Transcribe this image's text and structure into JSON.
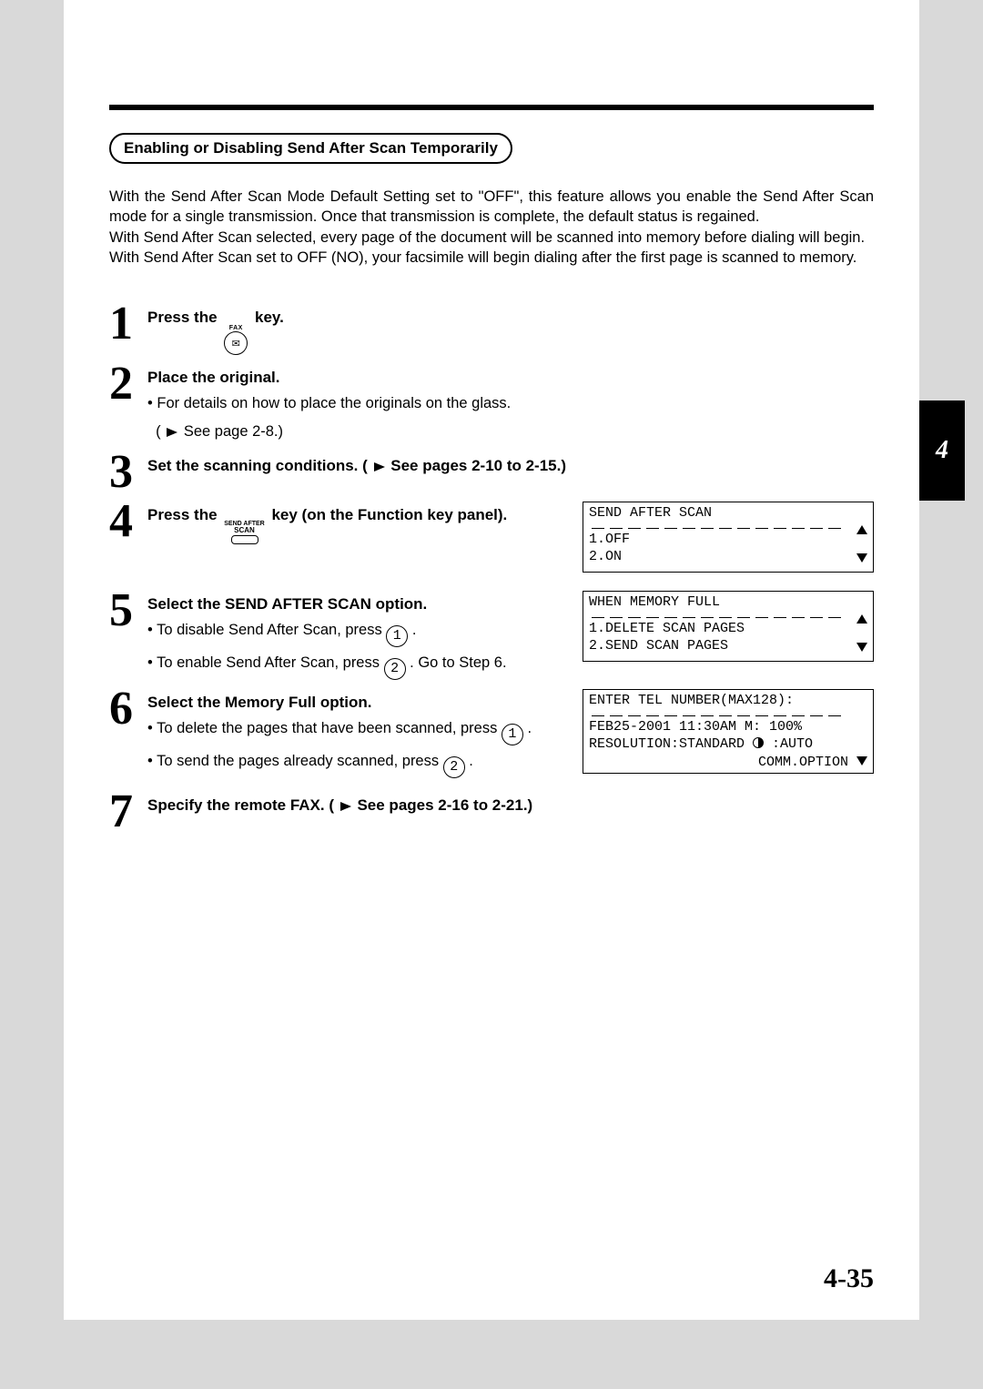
{
  "chapter_tab": "4",
  "section_title": "Enabling or Disabling Send After Scan Temporarily",
  "intro": {
    "p1": "With the Send After Scan Mode Default Setting set to \"OFF\", this feature allows you enable the Send After Scan mode for a single transmission.  Once that transmission is complete, the default status is regained.",
    "p2": "With Send After Scan selected, every page of the document will be scanned into memory before dialing will begin.",
    "p3": "With Send After Scan set to OFF (NO), your facsimile will begin dialing after the first page is scanned to memory."
  },
  "fax_label": "FAX",
  "send_after_label_1": "SEND AFTER",
  "send_after_label_2": "SCAN",
  "steps": {
    "s1": {
      "num": "1",
      "head_a": "Press the ",
      "head_b": " key."
    },
    "s2": {
      "num": "2",
      "head": "Place the original.",
      "sub1": "For details on how to place the originals on the glass.",
      "sub2": "See page 2-8.)"
    },
    "s3": {
      "num": "3",
      "head_a": "Set the scanning conditions. ( ",
      "head_b": " See pages 2-10 to 2-15.)"
    },
    "s4": {
      "num": "4",
      "head_a": "Press the ",
      "head_b": " key (on the Function key panel)."
    },
    "s5": {
      "num": "5",
      "head": "Select the SEND AFTER SCAN option.",
      "sub1a": "To disable Send After Scan, press ",
      "sub1b": " .",
      "sub2a": "To enable Send After Scan, press ",
      "sub2b": " . Go to Step 6."
    },
    "s6": {
      "num": "6",
      "head": "Select the Memory Full option.",
      "sub1a": "To delete the pages that have been scanned, press ",
      "sub1b": " .",
      "sub2a": "To send the pages already scanned, press ",
      "sub2b": " ."
    },
    "s7": {
      "num": "7",
      "head_a": "Specify the remote FAX. ( ",
      "head_b": " See pages 2-16 to 2-21.)"
    }
  },
  "key_1": "1",
  "key_2": "2",
  "displays": {
    "d1": {
      "l1": "SEND AFTER SCAN",
      "l2": "1.OFF",
      "l3": "2.ON"
    },
    "d2": {
      "l1": "WHEN MEMORY FULL",
      "l2": "1.DELETE SCAN PAGES",
      "l3": "2.SEND SCAN PAGES"
    },
    "d3": {
      "l1": "ENTER TEL NUMBER(MAX128):",
      "l2": "FEB25-2001 11:30AM M: 100%",
      "l3a": "RESOLUTION:STANDARD ",
      "l3b": " :AUTO",
      "l4": "COMM.OPTION"
    }
  },
  "page_number": "4-35"
}
